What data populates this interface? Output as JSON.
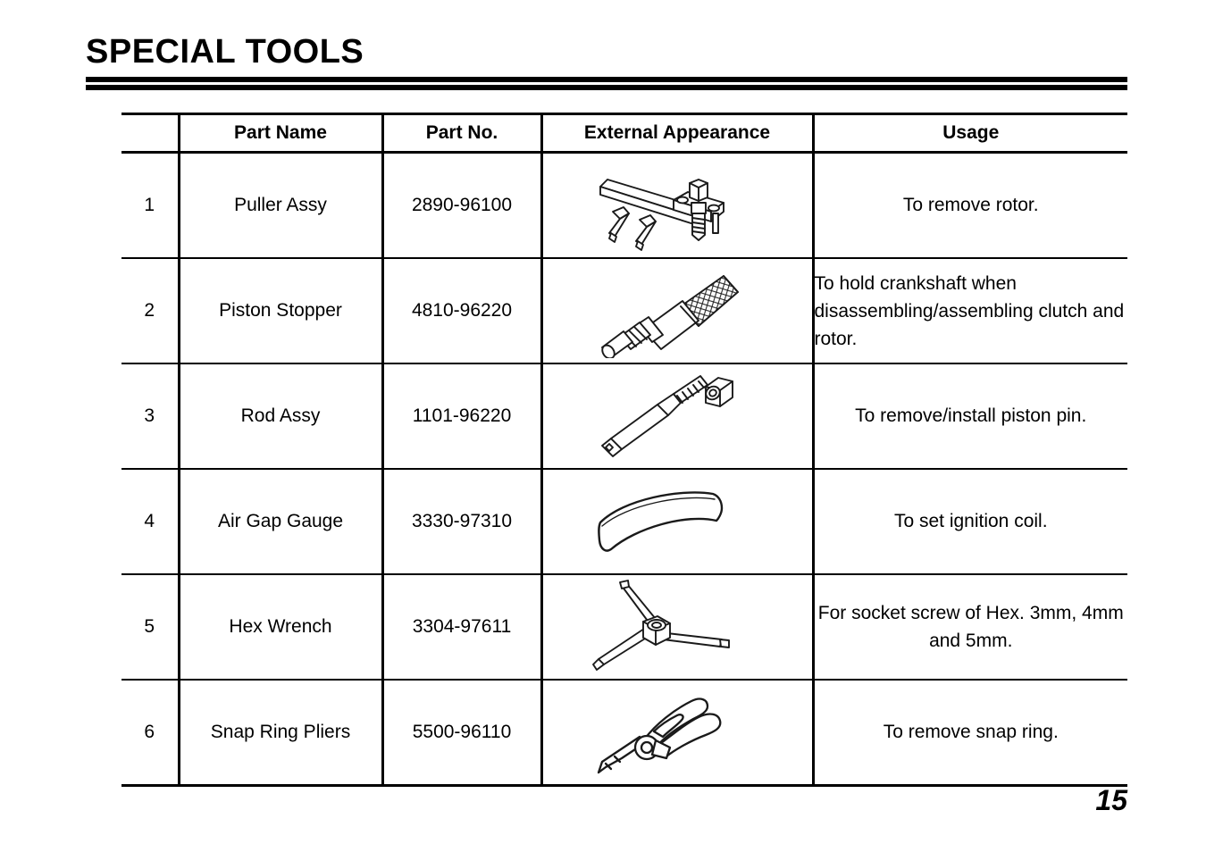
{
  "document": {
    "title": "SPECIAL TOOLS",
    "page_number": "15"
  },
  "table": {
    "headers": {
      "number": "",
      "part_name": "Part Name",
      "part_no": "Part No.",
      "external_appearance": "External Appearance",
      "usage": "Usage"
    },
    "rows": [
      {
        "no": "1",
        "part_name": "Puller Assy",
        "part_no": "2890-96100",
        "appearance_icon": "puller-assy-drawing",
        "usage": "To remove rotor.",
        "usage_align": "center"
      },
      {
        "no": "2",
        "part_name": "Piston Stopper",
        "part_no": "4810-96220",
        "appearance_icon": "piston-stopper-drawing",
        "usage": "To hold crankshaft when disassembling/assembling clutch and rotor.",
        "usage_align": "left"
      },
      {
        "no": "3",
        "part_name": "Rod Assy",
        "part_no": "1101-96220",
        "appearance_icon": "rod-assy-drawing",
        "usage": "To remove/install piston pin.",
        "usage_align": "center"
      },
      {
        "no": "4",
        "part_name": "Air Gap Gauge",
        "part_no": "3330-97310",
        "appearance_icon": "air-gap-gauge-drawing",
        "usage": "To set ignition coil.",
        "usage_align": "center"
      },
      {
        "no": "5",
        "part_name": "Hex Wrench",
        "part_no": "3304-97611",
        "appearance_icon": "hex-wrench-drawing",
        "usage": "For socket screw of Hex. 3mm, 4mm and 5mm.",
        "usage_align": "center"
      },
      {
        "no": "6",
        "part_name": "Snap Ring Pliers",
        "part_no": "5500-96110",
        "appearance_icon": "snap-ring-pliers-drawing",
        "usage": "To remove snap ring.",
        "usage_align": "center"
      }
    ]
  },
  "colors": {
    "ink": "#000000",
    "paper": "#ffffff"
  }
}
